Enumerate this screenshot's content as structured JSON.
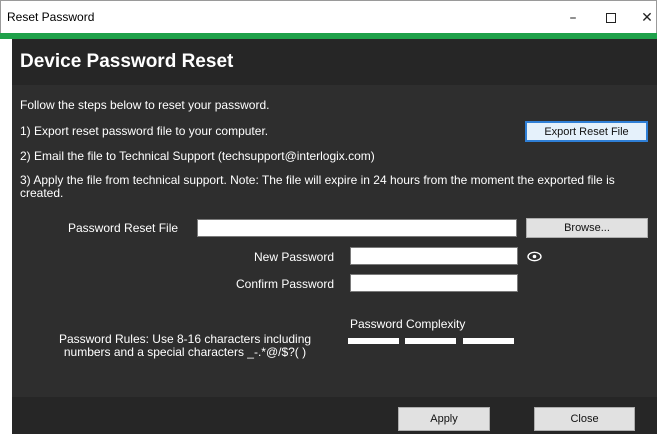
{
  "window": {
    "title": "Reset Password",
    "controls": {
      "minimize": "–",
      "close": "✕"
    }
  },
  "header": {
    "heading": "Device Password Reset"
  },
  "steps": {
    "intro": "Follow the steps below to reset your password.",
    "step1": "1)  Export reset password file to your computer.",
    "step2": "2)  Email the file to Technical Support (techsupport@interlogix.com)",
    "step3": "3) Apply the file from technical support. Note:  The file will expire in 24 hours from the moment the exported file is created."
  },
  "buttons": {
    "export": "Export Reset File",
    "browse": "Browse...",
    "apply": "Apply",
    "close": "Close"
  },
  "form": {
    "reset_file_label": "Password Reset File",
    "reset_file_value": "",
    "new_password_label": "New Password",
    "new_password_value": "",
    "confirm_password_label": "Confirm Password",
    "confirm_password_value": ""
  },
  "rules": {
    "text": "Password Rules: Use 8-16 characters including numbers and a special characters  _-.*@/$?( )"
  },
  "complexity": {
    "label": "Password Complexity",
    "segments": 3,
    "filled": 0
  },
  "icons": {
    "show_password": "eye-icon"
  },
  "colors": {
    "accent_bar": "#1fa14a",
    "panel_bg": "#2e2e2e",
    "header_bg": "#262626"
  }
}
